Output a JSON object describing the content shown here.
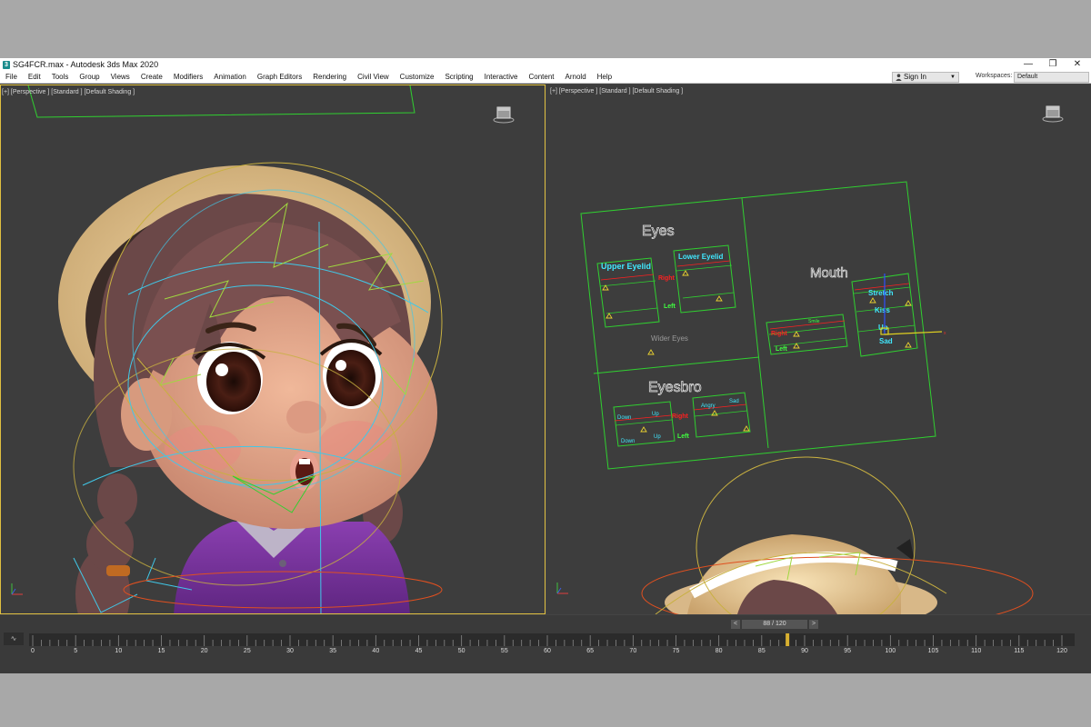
{
  "window": {
    "title": "SG4FCR.max - Autodesk 3ds Max 2020",
    "app_icon": "3ds-max-logo",
    "controls": [
      "—",
      "❐",
      "✕"
    ]
  },
  "menu": [
    "File",
    "Edit",
    "Tools",
    "Group",
    "Views",
    "Create",
    "Modifiers",
    "Animation",
    "Graph Editors",
    "Rendering",
    "Civil View",
    "Customize",
    "Scripting",
    "Interactive",
    "Content",
    "Arnold",
    "Help"
  ],
  "account": {
    "sign_in": "Sign In",
    "workspaces_label": "Workspaces:",
    "workspace": "Default"
  },
  "viewports": {
    "left": {
      "label": "[+] [Perspective ] [Standard ] [Default Shading ]",
      "active_border": "#e0c040"
    },
    "right": {
      "label": "[+] [Perspective ] [Standard ] [Default Shading ]"
    }
  },
  "face_ui": {
    "eyes_title": "Eyes",
    "upper_eyelid": "Upper Eyelid",
    "lower_eyelid": "Lower Eyelid",
    "right": "Right",
    "left": "Left",
    "wider_eyes": "Wider Eyes",
    "eyesbro_title": "Eyesbro",
    "down": "Down",
    "up": "Up",
    "angry": "Angry",
    "sad": "Sad",
    "mouth_title": "Mouth",
    "smile": "Smile",
    "stretch": "Stretch",
    "kiss": "Kiss",
    "mouth_up": "Up",
    "mouth_sad": "Sad"
  },
  "timeline": {
    "frame_display": "88 / 120",
    "current_frame": 88,
    "total_frames": 120,
    "ticks": [
      0,
      5,
      10,
      15,
      20,
      25,
      30,
      35,
      40,
      45,
      50,
      55,
      60,
      65,
      70,
      75,
      80,
      85,
      90,
      95,
      100,
      105,
      110,
      115,
      120
    ],
    "prev": "<",
    "next": ">",
    "curve_icon": "curve-editor-icon"
  },
  "colors": {
    "wire_green": "#30d030",
    "wire_cyan": "#40c8e8",
    "wire_yellow": "#c8b040",
    "label_cyan": "#40e8ff",
    "label_red": "#ff2020",
    "label_green": "#40ff40"
  }
}
